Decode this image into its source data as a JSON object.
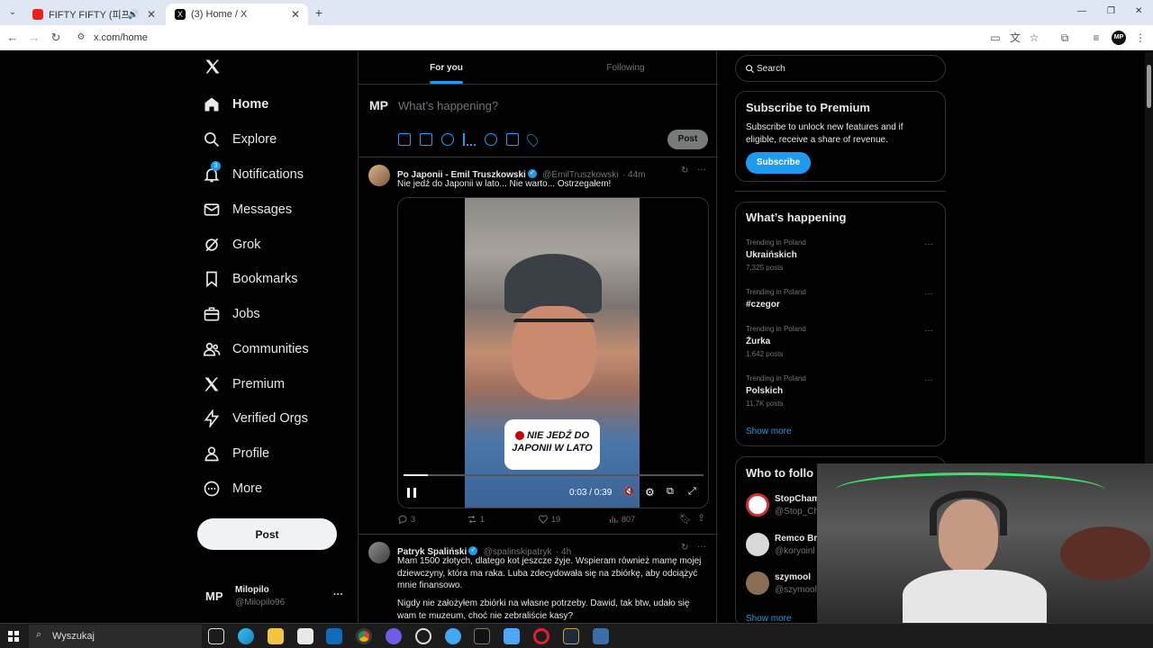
{
  "browser": {
    "tabs": [
      {
        "title": "FIFTY FIFTY (피프티피프티) ...",
        "active": false
      },
      {
        "title": "(3) Home / X",
        "active": true
      }
    ],
    "new_tab": "+",
    "url": "x.com/home",
    "profile": "MP",
    "window_controls": [
      "—",
      "❐",
      "✕"
    ]
  },
  "nav": {
    "logo": "X",
    "items": [
      {
        "label": "Home",
        "icon": "home-icon"
      },
      {
        "label": "Explore",
        "icon": "search-icon"
      },
      {
        "label": "Notifications",
        "icon": "bell-icon",
        "badge": "3"
      },
      {
        "label": "Messages",
        "icon": "mail-icon"
      },
      {
        "label": "Grok",
        "icon": "grok-icon"
      },
      {
        "label": "Bookmarks",
        "icon": "bookmark-icon"
      },
      {
        "label": "Jobs",
        "icon": "briefcase-icon"
      },
      {
        "label": "Communities",
        "icon": "people-icon"
      },
      {
        "label": "Premium",
        "icon": "x-icon"
      },
      {
        "label": "Verified Orgs",
        "icon": "bolt-icon"
      },
      {
        "label": "Profile",
        "icon": "person-icon"
      },
      {
        "label": "More",
        "icon": "more-circle-icon"
      }
    ],
    "post_button": "Post",
    "account": {
      "avatar": "MP",
      "name": "Milopilo",
      "handle": "@Milopilo96",
      "menu": "···"
    }
  },
  "feed": {
    "tabs": [
      "For you",
      "Following"
    ],
    "composer": {
      "avatar": "MP",
      "placeholder": "What’s happening?",
      "post_button": "Post"
    },
    "tweets": [
      {
        "name": "Po Japonii - Emil Truszkowski",
        "handle": "@EmilTruszkowski",
        "time": "· 44m",
        "text": "Nie jedź do Japonii w lato... Nie warto... Ostrzegałem!",
        "video": {
          "caption_line1": "NIE JEDŹ DO",
          "caption_line2": "JAPONII W LATO",
          "time": "0:03 / 0:39",
          "progress": 0.08
        },
        "replies": "3",
        "reposts": "1",
        "likes": "19",
        "views": "807"
      },
      {
        "name": "Patryk Spaliński",
        "handle": "@spalinskipatryk",
        "time": "· 4h",
        "text": "Mam 1500 złotych, dlatego kot jeszcze żyje. Wspieram również mamę mojej dziewczyny, która ma raka. Luba zdecydowała się na zbiórkę, aby odciążyć mnie finansowo.",
        "text2": "Nigdy nie założyłem zbiórki na własne potrzeby. Dawid, tak btw, udało się wam te muzeum, choć nie zebraliście kasy?"
      }
    ]
  },
  "sidebar": {
    "search_placeholder": "Search",
    "premium": {
      "title": "Subscribe to Premium",
      "text": "Subscribe to unlock new features and if eligible, receive a share of revenue.",
      "button": "Subscribe"
    },
    "happening": {
      "title": "What’s happening",
      "trends": [
        {
          "context": "Trending in Poland",
          "name": "Ukraińskich",
          "posts": "7,325 posts"
        },
        {
          "context": "Trending in Poland",
          "name": "#czegor",
          "posts": ""
        },
        {
          "context": "Trending in Poland",
          "name": "Żurka",
          "posts": "1,642 posts"
        },
        {
          "context": "Trending in Poland",
          "name": "Polskich",
          "posts": "11.7K posts"
        }
      ],
      "show_more": "Show more"
    },
    "who_to_follow": {
      "title": "Who to follo",
      "accounts": [
        {
          "name": "StopCham",
          "handle": "@Stop_Ch"
        },
        {
          "name": "Remco Br",
          "handle": "@koryoinl"
        },
        {
          "name": "szymool",
          "handle": "@szymool"
        }
      ],
      "show_more": "Show more"
    }
  },
  "taskbar": {
    "search": "Wyszukaj"
  },
  "colors": {
    "accent": "#1d9bf0",
    "background": "#000000",
    "border": "#2f3336",
    "muted": "#71767b"
  }
}
